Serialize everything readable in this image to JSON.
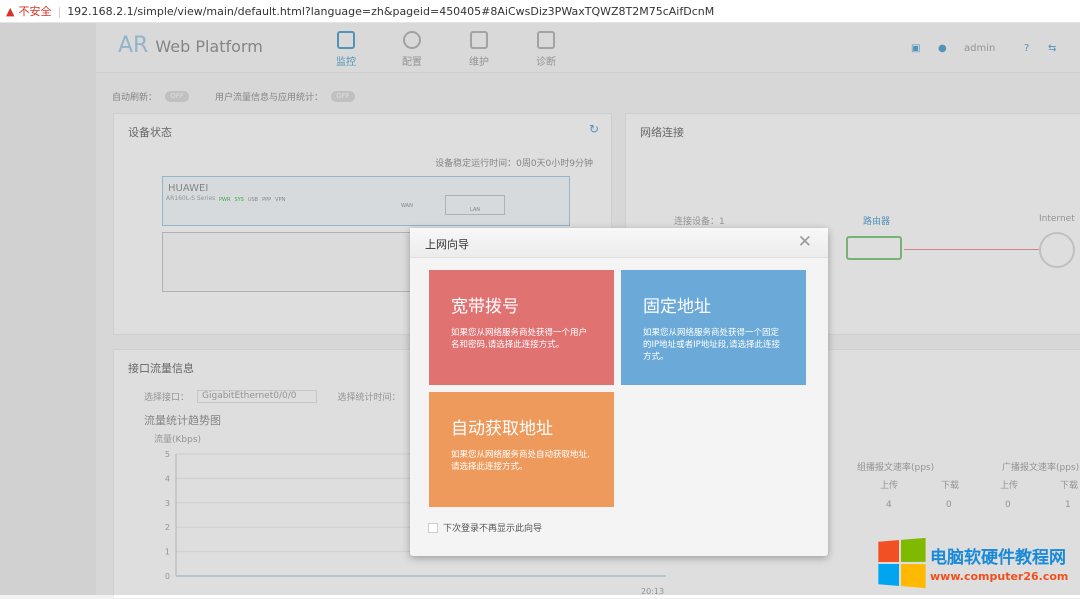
{
  "browser": {
    "security_label": "不安全",
    "url": "192.168.2.1/simple/view/main/default.html?language=zh&pageid=450405#8AiCwsDiz3PWaxTQWZ8T2M75cAifDcnM"
  },
  "header": {
    "logo_ar": "AR",
    "logo_text": "Web Platform",
    "nav": [
      {
        "label": "监控",
        "active": true
      },
      {
        "label": "配置"
      },
      {
        "label": "维护"
      },
      {
        "label": "诊断"
      }
    ],
    "user": "admin"
  },
  "toolbar": {
    "auto_refresh_label": "自动刷新：",
    "auto_refresh_state": "OFF",
    "user_stats_label": "用户流量信息与应用统计：",
    "user_stats_state": "OFF"
  },
  "device_status": {
    "title": "设备状态",
    "uptime": "设备稳定运行时间：0周0天0小时9分钟",
    "brand": "HUAWEI",
    "model": "AR160L-S Series",
    "leds": [
      "PWR",
      "SYS",
      "USB",
      "PPP",
      "VPN"
    ],
    "wan": "WAN",
    "lan": "LAN"
  },
  "network": {
    "title": "网络连接",
    "connected": "连接设备：1",
    "router": "路由器",
    "internet": "Internet"
  },
  "traffic": {
    "title": "接口流量信息",
    "select_interface_label": "选择接口：",
    "interface": "GigabitEthernet0/0/0",
    "select_time_label": "选择统计时间：",
    "chart_title": "流量统计趋势图",
    "time_label": "20:13"
  },
  "chart_data": {
    "type": "line",
    "ylabel": "流量(Kbps)",
    "ylim": [
      0,
      5
    ],
    "yticks": [
      "0",
      "1",
      "2",
      "3",
      "4",
      "5"
    ]
  },
  "stats_table": {
    "headers": [
      "组播报文速率(pps)",
      "广播报文速率(pps)"
    ],
    "sub": [
      "上传",
      "下载",
      "上传",
      "下载"
    ],
    "values": [
      "4",
      "0",
      "0",
      "1"
    ]
  },
  "modal": {
    "title": "上网向导",
    "cards": [
      {
        "title": "宽带拨号",
        "desc": "如果您从网络服务商处获得一个用户名和密码,请选择此连接方式。",
        "color": "#e07272"
      },
      {
        "title": "固定地址",
        "desc": "如果您从网络服务商处获得一个固定的IP地址或者IP地址段,请选择此连接方式。",
        "color": "#6aa9d8"
      },
      {
        "title": "自动获取地址",
        "desc": "如果您从网络服务商处自动获取地址,请选择此连接方式。",
        "color": "#ee9a5c"
      }
    ],
    "dont_show": "下次登录不再显示此向导"
  },
  "watermark": {
    "title": "电脑软硬件教程网",
    "url": "www.computer26.com"
  }
}
